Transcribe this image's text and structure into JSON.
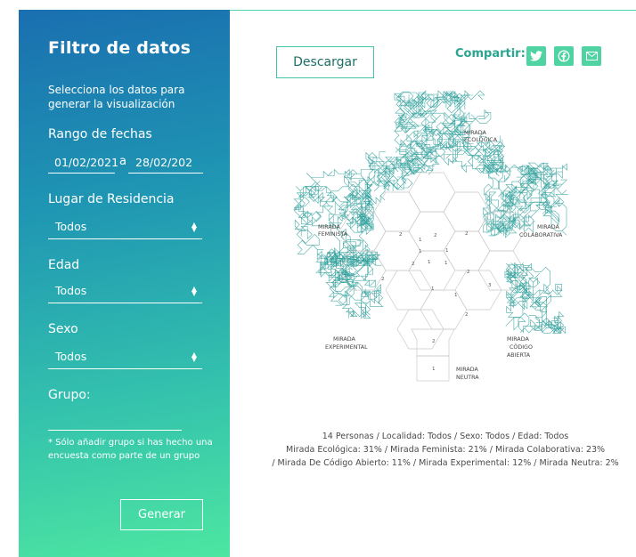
{
  "filter": {
    "title": "Filtro de datos",
    "intro": "Selecciona los datos para generar la visualización",
    "date_range_label": "Rango de fechas",
    "date_from": "01/02/2021",
    "date_sep": "a",
    "date_to": "28/02/202",
    "residence_label": "Lugar de Residencia",
    "residence_value": "Todos",
    "age_label": "Edad",
    "age_value": "Todos",
    "sex_label": "Sexo",
    "sex_value": "Todos",
    "group_label": "Grupo:",
    "group_note": "* Sólo añadir grupo si has hecho una encuesta como parte de un grupo",
    "generate_label": "Generar"
  },
  "actions": {
    "download_label": "Descargar",
    "share_label": "Compartir:",
    "share_icons": [
      "twitter-icon",
      "facebook-icon",
      "email-icon"
    ],
    "accent_color": "#4fd3a2"
  },
  "visualization": {
    "labels": {
      "ecologica": [
        "MIRADA",
        "ECOLÓGICA"
      ],
      "feminista": [
        "MIRADA",
        "FEMINISTA"
      ],
      "colaborativa": [
        "MIRADA",
        "COLABORATIVA"
      ],
      "experimental": [
        "MIRADA",
        "EXPERIMENTAL"
      ],
      "codigo": [
        "MIRADA",
        "CÓDIGO",
        "ABIERTA"
      ],
      "neutra": [
        "MIRADA",
        "NEUTRA"
      ]
    },
    "hex_numbers": [
      "2",
      "1",
      "2",
      "2",
      "1",
      "1",
      "2",
      "1",
      "1",
      "2",
      "2",
      "1",
      "3",
      "1",
      "2",
      "2",
      "1"
    ],
    "walk_color": "#2a9d99"
  },
  "summary": {
    "line1": "14 Personas / Localidad: Todos / Sexo: Todos / Edad: Todos",
    "line2": "Mirada Ecológica: 31%  / Mirada Feminista: 21%  / Mirada Colaborativa: 23%",
    "line3": "/ Mirada De Código Abierto: 11%  / Mirada Experimental: 12%  / Mirada Neutra: 2%"
  }
}
